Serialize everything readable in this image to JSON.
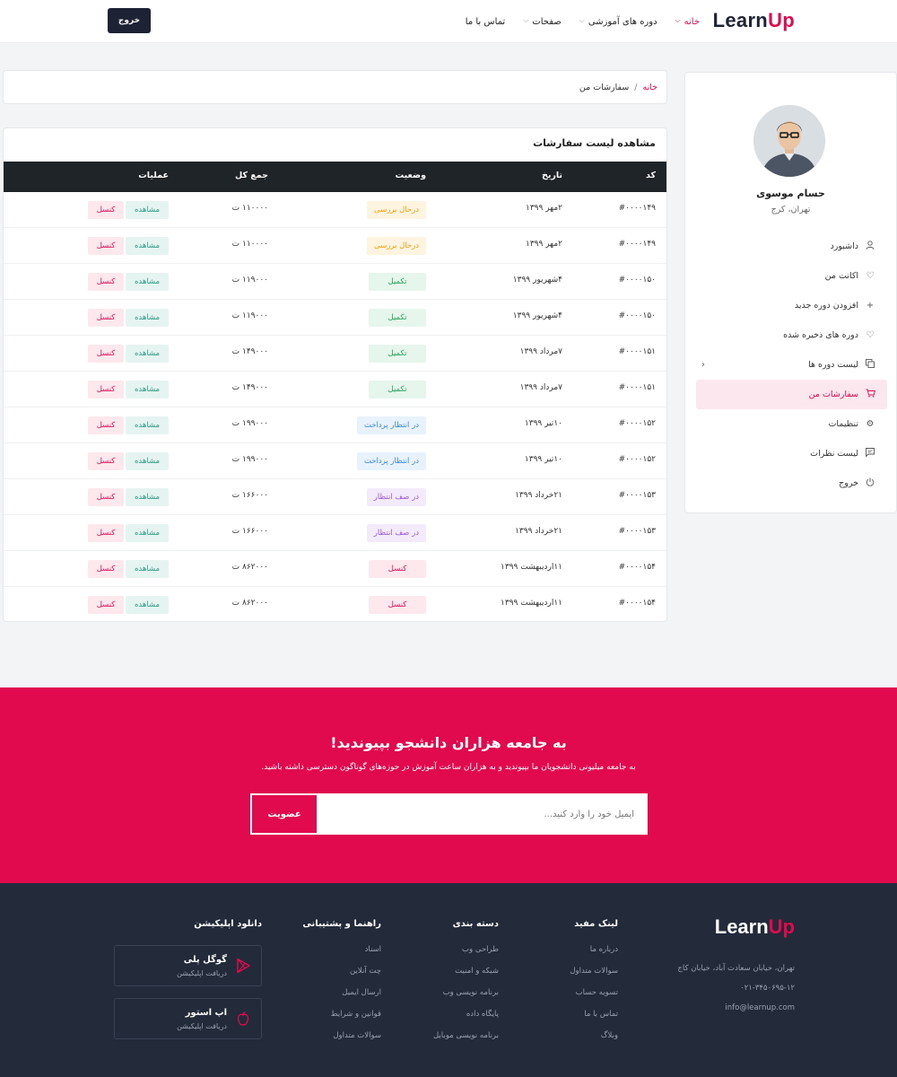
{
  "header": {
    "logo_prefix": "Learn",
    "logo_suffix": "Up",
    "nav": [
      {
        "label": "خانه",
        "has_dropdown": true,
        "active": true
      },
      {
        "label": "دوره های آموزشی",
        "has_dropdown": true,
        "active": false
      },
      {
        "label": "صفحات",
        "has_dropdown": true,
        "active": false
      },
      {
        "label": "تماس با ما",
        "has_dropdown": false,
        "active": false
      }
    ],
    "logout_label": "خروج"
  },
  "profile": {
    "name": "حسام موسوی",
    "city": "تهران، کرج",
    "menu": [
      {
        "label": "داشبورد",
        "icon": "user-icon"
      },
      {
        "label": "اکانت من",
        "icon": "heart-icon"
      },
      {
        "label": "افزودن دوره جدید",
        "icon": "plus-icon"
      },
      {
        "label": "دوره های ذخیره شده",
        "icon": "heart-icon"
      },
      {
        "label": "لیست دوره ها",
        "icon": "copy-icon",
        "has_submenu": true
      },
      {
        "label": "سفارشات من",
        "icon": "cart-icon",
        "active": true
      },
      {
        "label": "تنظیمات",
        "icon": "gear-icon"
      },
      {
        "label": "لیست نظرات",
        "icon": "comment-icon"
      },
      {
        "label": "خروج",
        "icon": "power-icon"
      }
    ]
  },
  "breadcrumb": {
    "home": "خانه",
    "separator": "/",
    "current": "سفارشات من"
  },
  "orders": {
    "title": "مشاهده لیست سفارشات",
    "columns": {
      "code": "کد",
      "date": "تاریخ",
      "status": "وضعیت",
      "total": "جمع کل",
      "actions": "عملیات"
    },
    "view_label": "مشاهده",
    "cancel_label": "کنسل",
    "rows": [
      {
        "code": "#۰۰۰۰۱۴۹",
        "date": "۲مهر ۱۳۹۹",
        "status": "درحال بررسی",
        "status_type": "review",
        "total": "۱۱۰۰۰۰ ت"
      },
      {
        "code": "#۰۰۰۰۱۴۹",
        "date": "۲مهر ۱۳۹۹",
        "status": "درحال بررسی",
        "status_type": "review",
        "total": "۱۱۰۰۰۰ ت"
      },
      {
        "code": "#۰۰۰۰۱۵۰",
        "date": "۴شهریور ۱۳۹۹",
        "status": "تکمیل",
        "status_type": "done",
        "total": "۱۱۹۰۰۰ ت"
      },
      {
        "code": "#۰۰۰۰۱۵۰",
        "date": "۴شهریور ۱۳۹۹",
        "status": "تکمیل",
        "status_type": "done",
        "total": "۱۱۹۰۰۰ ت"
      },
      {
        "code": "#۰۰۰۰۱۵۱",
        "date": "۷مرداد ۱۳۹۹",
        "status": "تکمیل",
        "status_type": "done",
        "total": "۱۴۹۰۰۰ ت"
      },
      {
        "code": "#۰۰۰۰۱۵۱",
        "date": "۷مرداد ۱۳۹۹",
        "status": "تکمیل",
        "status_type": "done",
        "total": "۱۴۹۰۰۰ ت"
      },
      {
        "code": "#۰۰۰۰۱۵۲",
        "date": "۱۰تیر ۱۳۹۹",
        "status": "در انتظار پرداخت",
        "status_type": "pending",
        "total": "۱۹۹۰۰۰ ت"
      },
      {
        "code": "#۰۰۰۰۱۵۲",
        "date": "۱۰تیر ۱۳۹۹",
        "status": "در انتظار پرداخت",
        "status_type": "pending",
        "total": "۱۹۹۰۰۰ ت"
      },
      {
        "code": "#۰۰۰۰۱۵۳",
        "date": "۲۱خرداد ۱۳۹۹",
        "status": "در صف انتظار",
        "status_type": "queue",
        "total": "۱۶۶۰۰۰ ت"
      },
      {
        "code": "#۰۰۰۰۱۵۳",
        "date": "۲۱خرداد ۱۳۹۹",
        "status": "در صف انتظار",
        "status_type": "queue",
        "total": "۱۶۶۰۰۰ ت"
      },
      {
        "code": "#۰۰۰۰۱۵۴",
        "date": "۱۱اردیبهشت ۱۳۹۹",
        "status": "کنسل",
        "status_type": "cancelled",
        "total": "۸۶۲۰۰۰ ت"
      },
      {
        "code": "#۰۰۰۰۱۵۴",
        "date": "۱۱اردیبهشت ۱۳۹۹",
        "status": "کنسل",
        "status_type": "cancelled",
        "total": "۸۶۲۰۰۰ ت"
      }
    ]
  },
  "join": {
    "title": "به جامعه هزاران دانشجو بپیوندید!",
    "subtitle": "به جامعه میلیونی دانشجویان ما بپیوندید و به هزاران ساعت آموزش در حوزه‌های گوناگون دسترسی داشته باشید.",
    "email_placeholder": "ایمیل خود را وارد کنید...",
    "button_label": "عضویت"
  },
  "footer": {
    "logo_prefix": "Learn",
    "logo_suffix": "Up",
    "address": "تهران، خیابان سعادت آباد، خیابان کاج",
    "phone": "۰۲۱-۳۴۵۰۶۹۵-۱۲",
    "email": "info@learnup.com",
    "columns": [
      {
        "title": "لینک مفید",
        "links": [
          "درباره ما",
          "سوالات متداول",
          "تسویه حساب",
          "تماس با ما",
          "وبلاگ"
        ]
      },
      {
        "title": "دسته بندی",
        "links": [
          "طراحی وب",
          "شبکه و امنیت",
          "برنامه نویسی وب",
          "پایگاه داده",
          "برنامه نویسی موبایل"
        ]
      },
      {
        "title": "راهنما و پشتیبانی",
        "links": [
          "اسناد",
          "چت آنلاین",
          "ارسال ایمیل",
          "قوانین و شرایط",
          "سوالات متداول"
        ]
      }
    ],
    "apps": {
      "title": "دانلود اپلیکیشن",
      "stores": [
        {
          "name": "گوگل پلی",
          "sub": "دریافت اپلیکیشن",
          "icon": "google-play-icon"
        },
        {
          "name": "اپ استور",
          "sub": "دریافت اپلیکیشن",
          "icon": "apple-icon"
        }
      ]
    }
  },
  "colors": {
    "brand": "#e20a4f",
    "dark": "#1e2235",
    "footer_bg": "#232a3a",
    "status_review": "#f59e0b",
    "status_done": "#22a05a",
    "status_pending": "#3b8ad9",
    "status_queue": "#9b59d0",
    "status_cancelled": "#e20a4f"
  }
}
